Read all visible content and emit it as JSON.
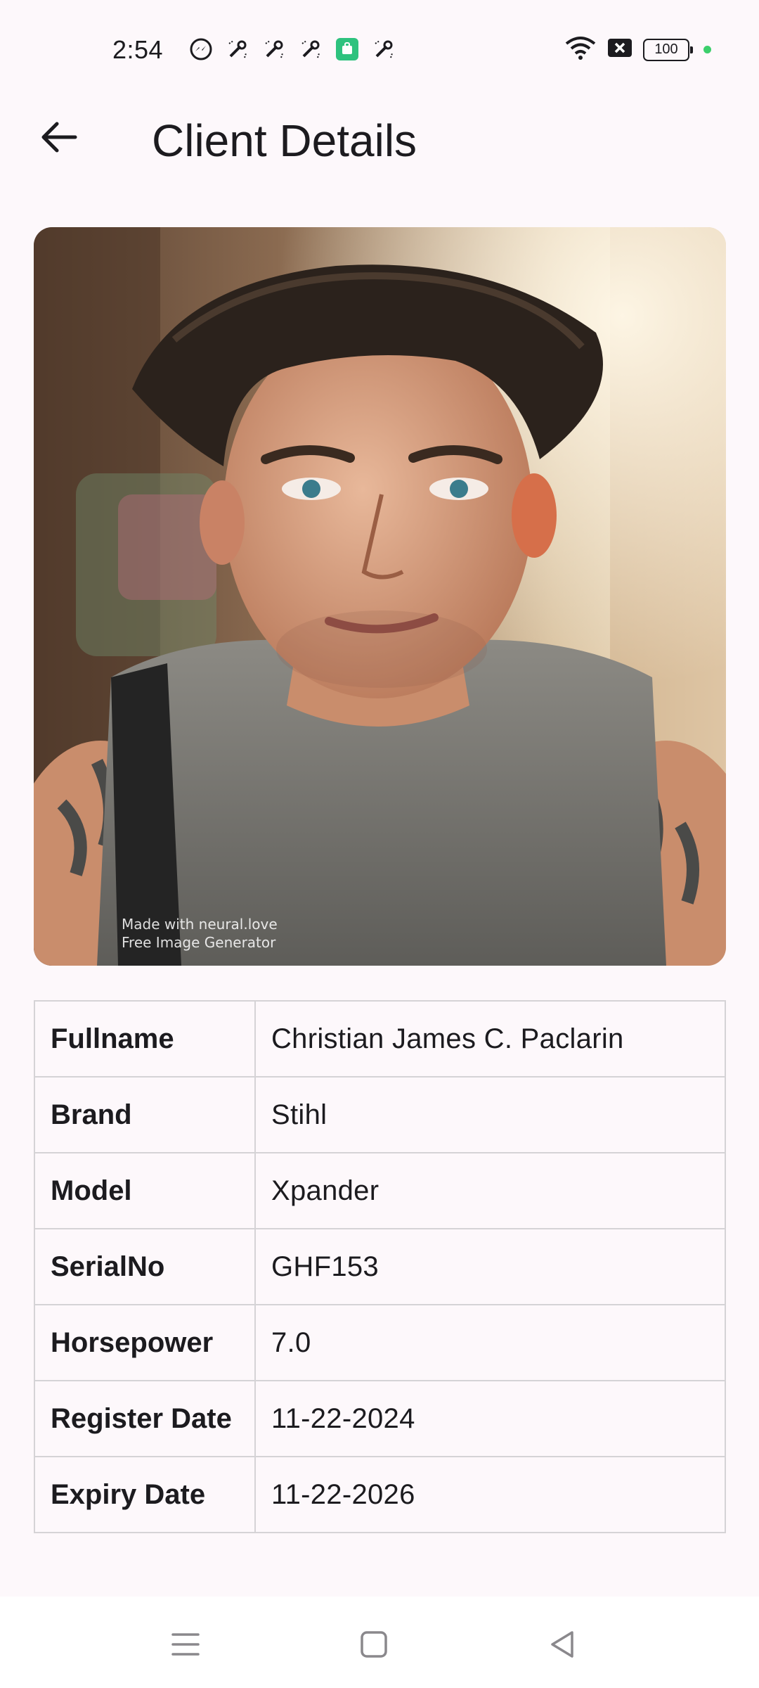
{
  "status_bar": {
    "time": "2:54",
    "battery": "100",
    "notification_icons": [
      "messenger-icon",
      "tool-icon",
      "tool-icon",
      "tool-icon",
      "app-store-icon",
      "tool-icon"
    ],
    "system_icons": [
      "wifi-icon",
      "no-sim-icon",
      "battery-icon",
      "charging-dot"
    ]
  },
  "app_bar": {
    "title": "Client Details",
    "back_icon": "arrow-left-icon"
  },
  "photo": {
    "watermark_line1": "Made with neural.love",
    "watermark_line2": "Free Image Generator"
  },
  "details": [
    {
      "label": "Fullname",
      "value": "Christian James C. Paclarin"
    },
    {
      "label": "Brand",
      "value": "Stihl"
    },
    {
      "label": "Model",
      "value": "Xpander"
    },
    {
      "label": "SerialNo",
      "value": "GHF153"
    },
    {
      "label": "Horsepower",
      "value": "7.0"
    },
    {
      "label": "Register Date",
      "value": "11-22-2024"
    },
    {
      "label": "Expiry Date",
      "value": "11-22-2026"
    }
  ],
  "nav_bar": {
    "icons": [
      "menu-icon",
      "home-square-icon",
      "back-triangle-icon"
    ]
  },
  "colors": {
    "background": "#fdf8fb",
    "text": "#1c1b1f",
    "table_border": "#d5d3d6",
    "charging_dot": "#3ccf6c"
  }
}
